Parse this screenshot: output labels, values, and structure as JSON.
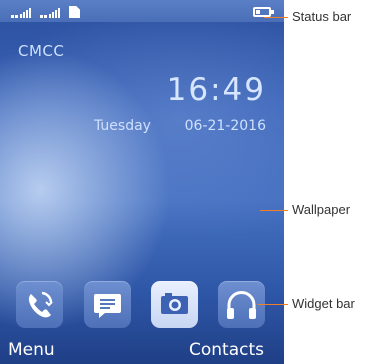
{
  "status_bar": {
    "sim1_icon": "signal-strength-sim1-icon",
    "sim2_icon": "signal-strength-sim2-icon",
    "storage_icon": "sd-card-icon",
    "battery_icon": "battery-icon"
  },
  "home": {
    "carrier": "CMCC",
    "time": "16:49",
    "day": "Tuesday",
    "date": "06-21-2016"
  },
  "widget_bar": {
    "items": [
      {
        "icon": "call-log-icon"
      },
      {
        "icon": "messages-icon"
      },
      {
        "icon": "camera-icon",
        "selected": true
      },
      {
        "icon": "headphones-icon"
      }
    ]
  },
  "softkeys": {
    "left": "Menu",
    "right": "Contacts"
  },
  "annotations": {
    "status_bar": "Status bar",
    "wallpaper": "Wallpaper",
    "widget_bar": "Widget bar"
  },
  "colors": {
    "callout_line": "#f07f2a",
    "wallpaper_blue": "#3a64b8"
  }
}
